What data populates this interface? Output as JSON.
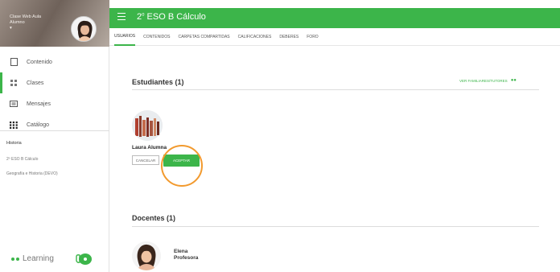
{
  "sidebar": {
    "user_name": "Clase Web Aula",
    "user_sub": "Alumno",
    "nav": [
      {
        "label": "Contenido",
        "icon": "document-icon"
      },
      {
        "label": "Clases",
        "icon": "grid-icon"
      },
      {
        "label": "Mensajes",
        "icon": "message-icon"
      },
      {
        "label": "Catálogo",
        "icon": "apps-icon"
      }
    ],
    "history_title": "Historia",
    "history": [
      "2º ESO B Cálculo",
      "Geografía e Historia (DEVO)"
    ],
    "brand": "Learning"
  },
  "topbar": {
    "title_num": "2",
    "title_sup": "o",
    "title_rest": "ESO B Cálculo"
  },
  "tabs": [
    "USUARIOS",
    "CONTENIDOS",
    "CARPETAS COMPARTIDAS",
    "CALIFICACIONES",
    "DEBERES",
    "FORO"
  ],
  "students": {
    "title": "Estudiantes (1)",
    "link": "VER FAMILIARES/TUTORES",
    "name": "Laura Alumna",
    "cancel": "CANCELAR",
    "accept": "ACEPTAR"
  },
  "teachers": {
    "title": "Docentes (1)",
    "first": "Elena",
    "last": "Profesora"
  },
  "colors": {
    "accent": "#3cb54a",
    "highlight": "#f29a2e"
  }
}
